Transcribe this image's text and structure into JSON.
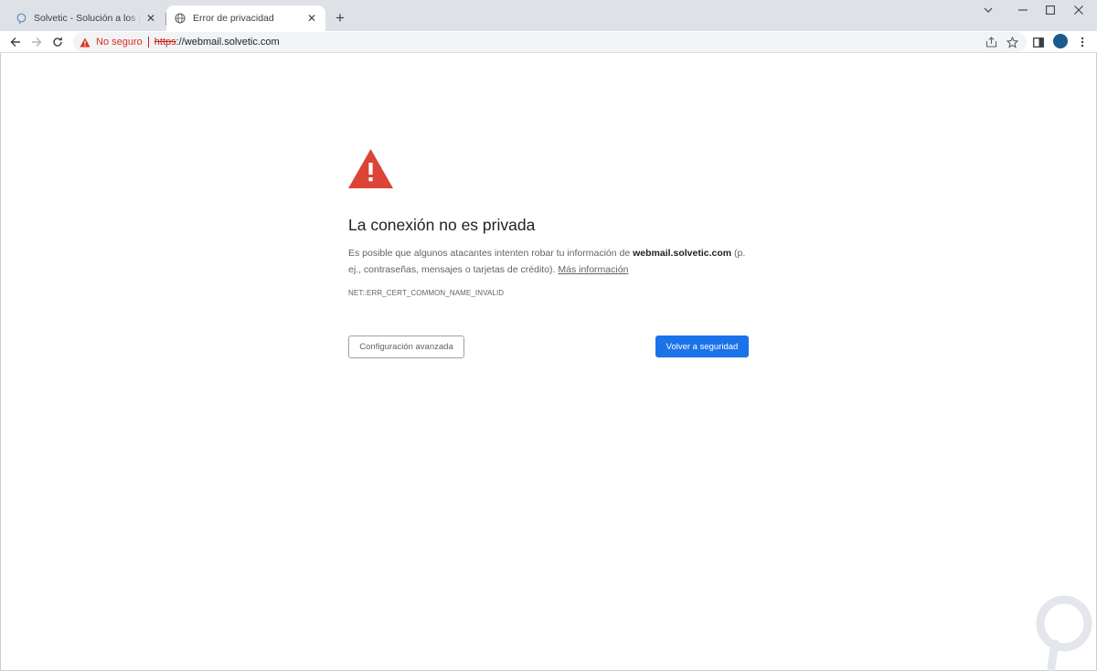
{
  "colors": {
    "tabstrip_bg": "#dee1e6",
    "danger": "#d93025",
    "primary_button": "#1a73e8",
    "text_primary": "#202124",
    "text_secondary": "#5f6368"
  },
  "tabs": [
    {
      "title": "Solvetic - Solución a los problemas",
      "favicon": "solvetic-icon",
      "active": false
    },
    {
      "title": "Error de privacidad",
      "favicon": "globe-icon",
      "active": true
    }
  ],
  "window_controls": [
    "chevron-down-icon",
    "minimize-icon",
    "maximize-icon",
    "close-icon"
  ],
  "omnibox": {
    "security_label": "No seguro",
    "scheme": "https",
    "rest_of_url": "://webmail.solvetic.com"
  },
  "interstitial": {
    "heading": "La conexión no es privada",
    "explanation_before": "Es posible que algunos atacantes intenten robar tu información de ",
    "domain": "webmail.solvetic.com",
    "explanation_after": " (p. ej., contraseñas, mensajes o tarjetas de crédito). ",
    "learn_more": "Más información",
    "error_code": "NET::ERR_CERT_COMMON_NAME_INVALID",
    "advanced_button": "Configuración avanzada",
    "back_button": "Volver a seguridad"
  }
}
